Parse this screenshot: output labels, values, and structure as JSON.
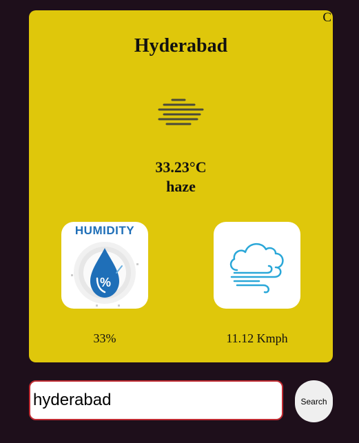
{
  "weather": {
    "corner_label": "C",
    "city": "Hyderabad",
    "condition_icon": "haze-icon",
    "temperature": "33.23°C",
    "description": "haze",
    "humidity": {
      "icon": "humidity-icon",
      "icon_text": "HUMIDITY",
      "icon_symbol": "%",
      "value": "33%"
    },
    "wind": {
      "icon": "wind-icon",
      "value": "11.12 Kmph"
    }
  },
  "search": {
    "value": "hyderabad",
    "button_label": "Search"
  },
  "colors": {
    "page_background": "#1e0f1b",
    "card_background": "#dfc70b",
    "input_border": "#c02b32",
    "humidity_blue": "#1f6fb8",
    "wind_blue": "#2aa7d8"
  }
}
